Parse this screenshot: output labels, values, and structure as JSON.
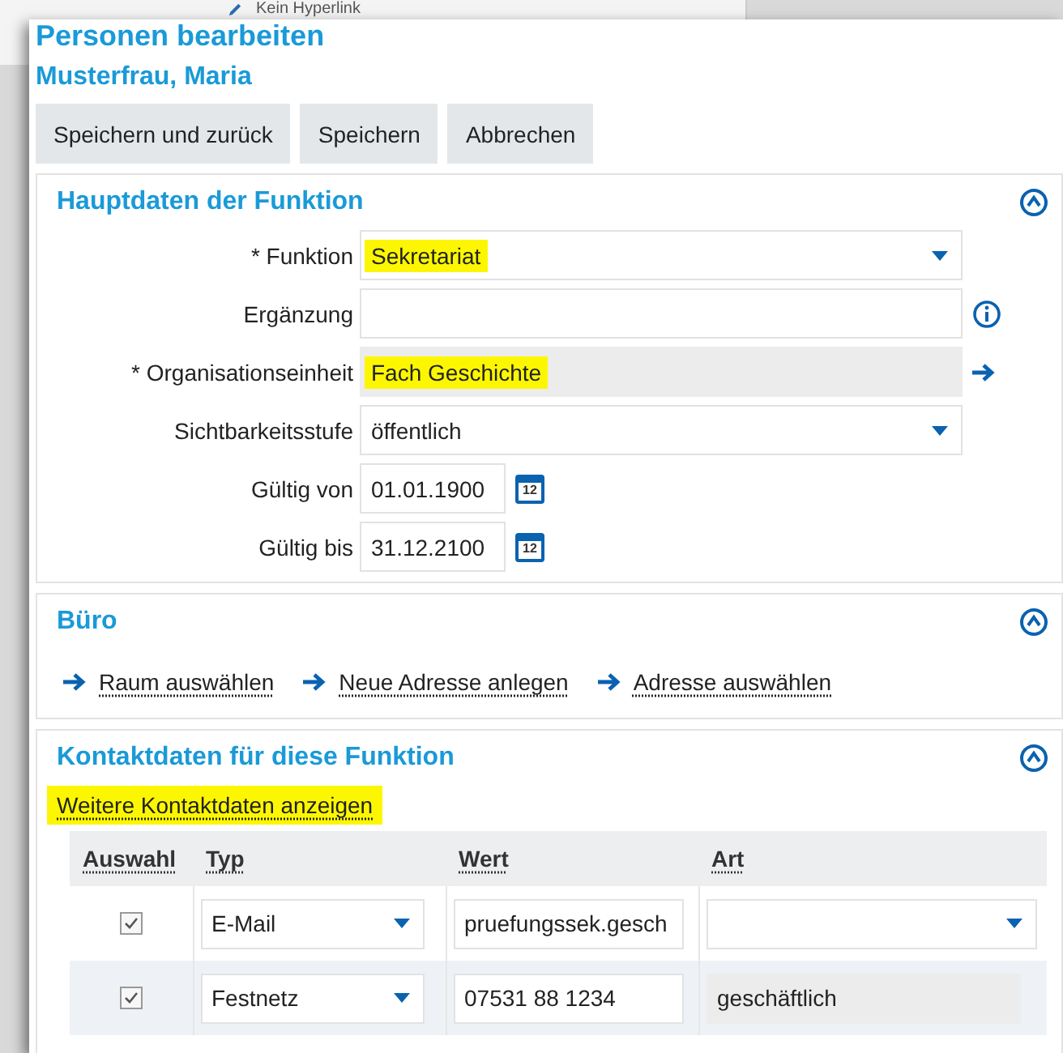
{
  "background": {
    "link": "Kein Hyperlink"
  },
  "dialog": {
    "title": "Personen bearbeiten",
    "subtitle": "Musterfrau, Maria",
    "buttons": [
      "Speichern und zurück",
      "Speichern",
      "Abbrechen"
    ]
  },
  "main_section": {
    "title": "Hauptdaten der Funktion",
    "expanded": true,
    "fields": [
      {
        "kind": "select",
        "label": "* Funktion",
        "value": "Sekretariat",
        "highlighted": true
      },
      {
        "kind": "text",
        "label": "Ergänzung",
        "info": true,
        "highlighted": false
      },
      {
        "kind": "readonly",
        "label": "* Organisationseinheit",
        "value": "Fach Geschichte",
        "highlighted": true,
        "link": true
      },
      {
        "kind": "select",
        "label": "Sichtbarkeitsstufe",
        "value": "öffentlich",
        "highlighted": false
      },
      {
        "kind": "date",
        "label": "Gültig von",
        "value": "01.01.1900",
        "highlighted": false,
        "calendar_day": "12"
      },
      {
        "kind": "date",
        "label": "Gültig bis",
        "value": "31.12.2100",
        "highlighted": false,
        "calendar_day": "12"
      }
    ]
  },
  "office_section": {
    "title": "Büro",
    "expanded": true,
    "links": [
      "Raum auswählen",
      "Neue Adresse anlegen",
      "Adresse auswählen"
    ]
  },
  "contact_section": {
    "title": "Kontaktdaten für diese Funktion",
    "expanded": true,
    "more_link": {
      "text": "Weitere Kontaktdaten anzeigen",
      "highlighted": true
    },
    "table": {
      "columns": [
        "Auswahl",
        "Typ",
        "Wert",
        "Art"
      ],
      "rows": [
        {
          "checked": true,
          "type": "E-Mail",
          "value": "pruefungssek.gesch",
          "art": {
            "kind": "select"
          }
        },
        {
          "checked": true,
          "type": "Festnetz",
          "value": "07531 88 1234",
          "art": {
            "kind": "readonly",
            "value": "geschäftlich"
          }
        }
      ]
    }
  }
}
